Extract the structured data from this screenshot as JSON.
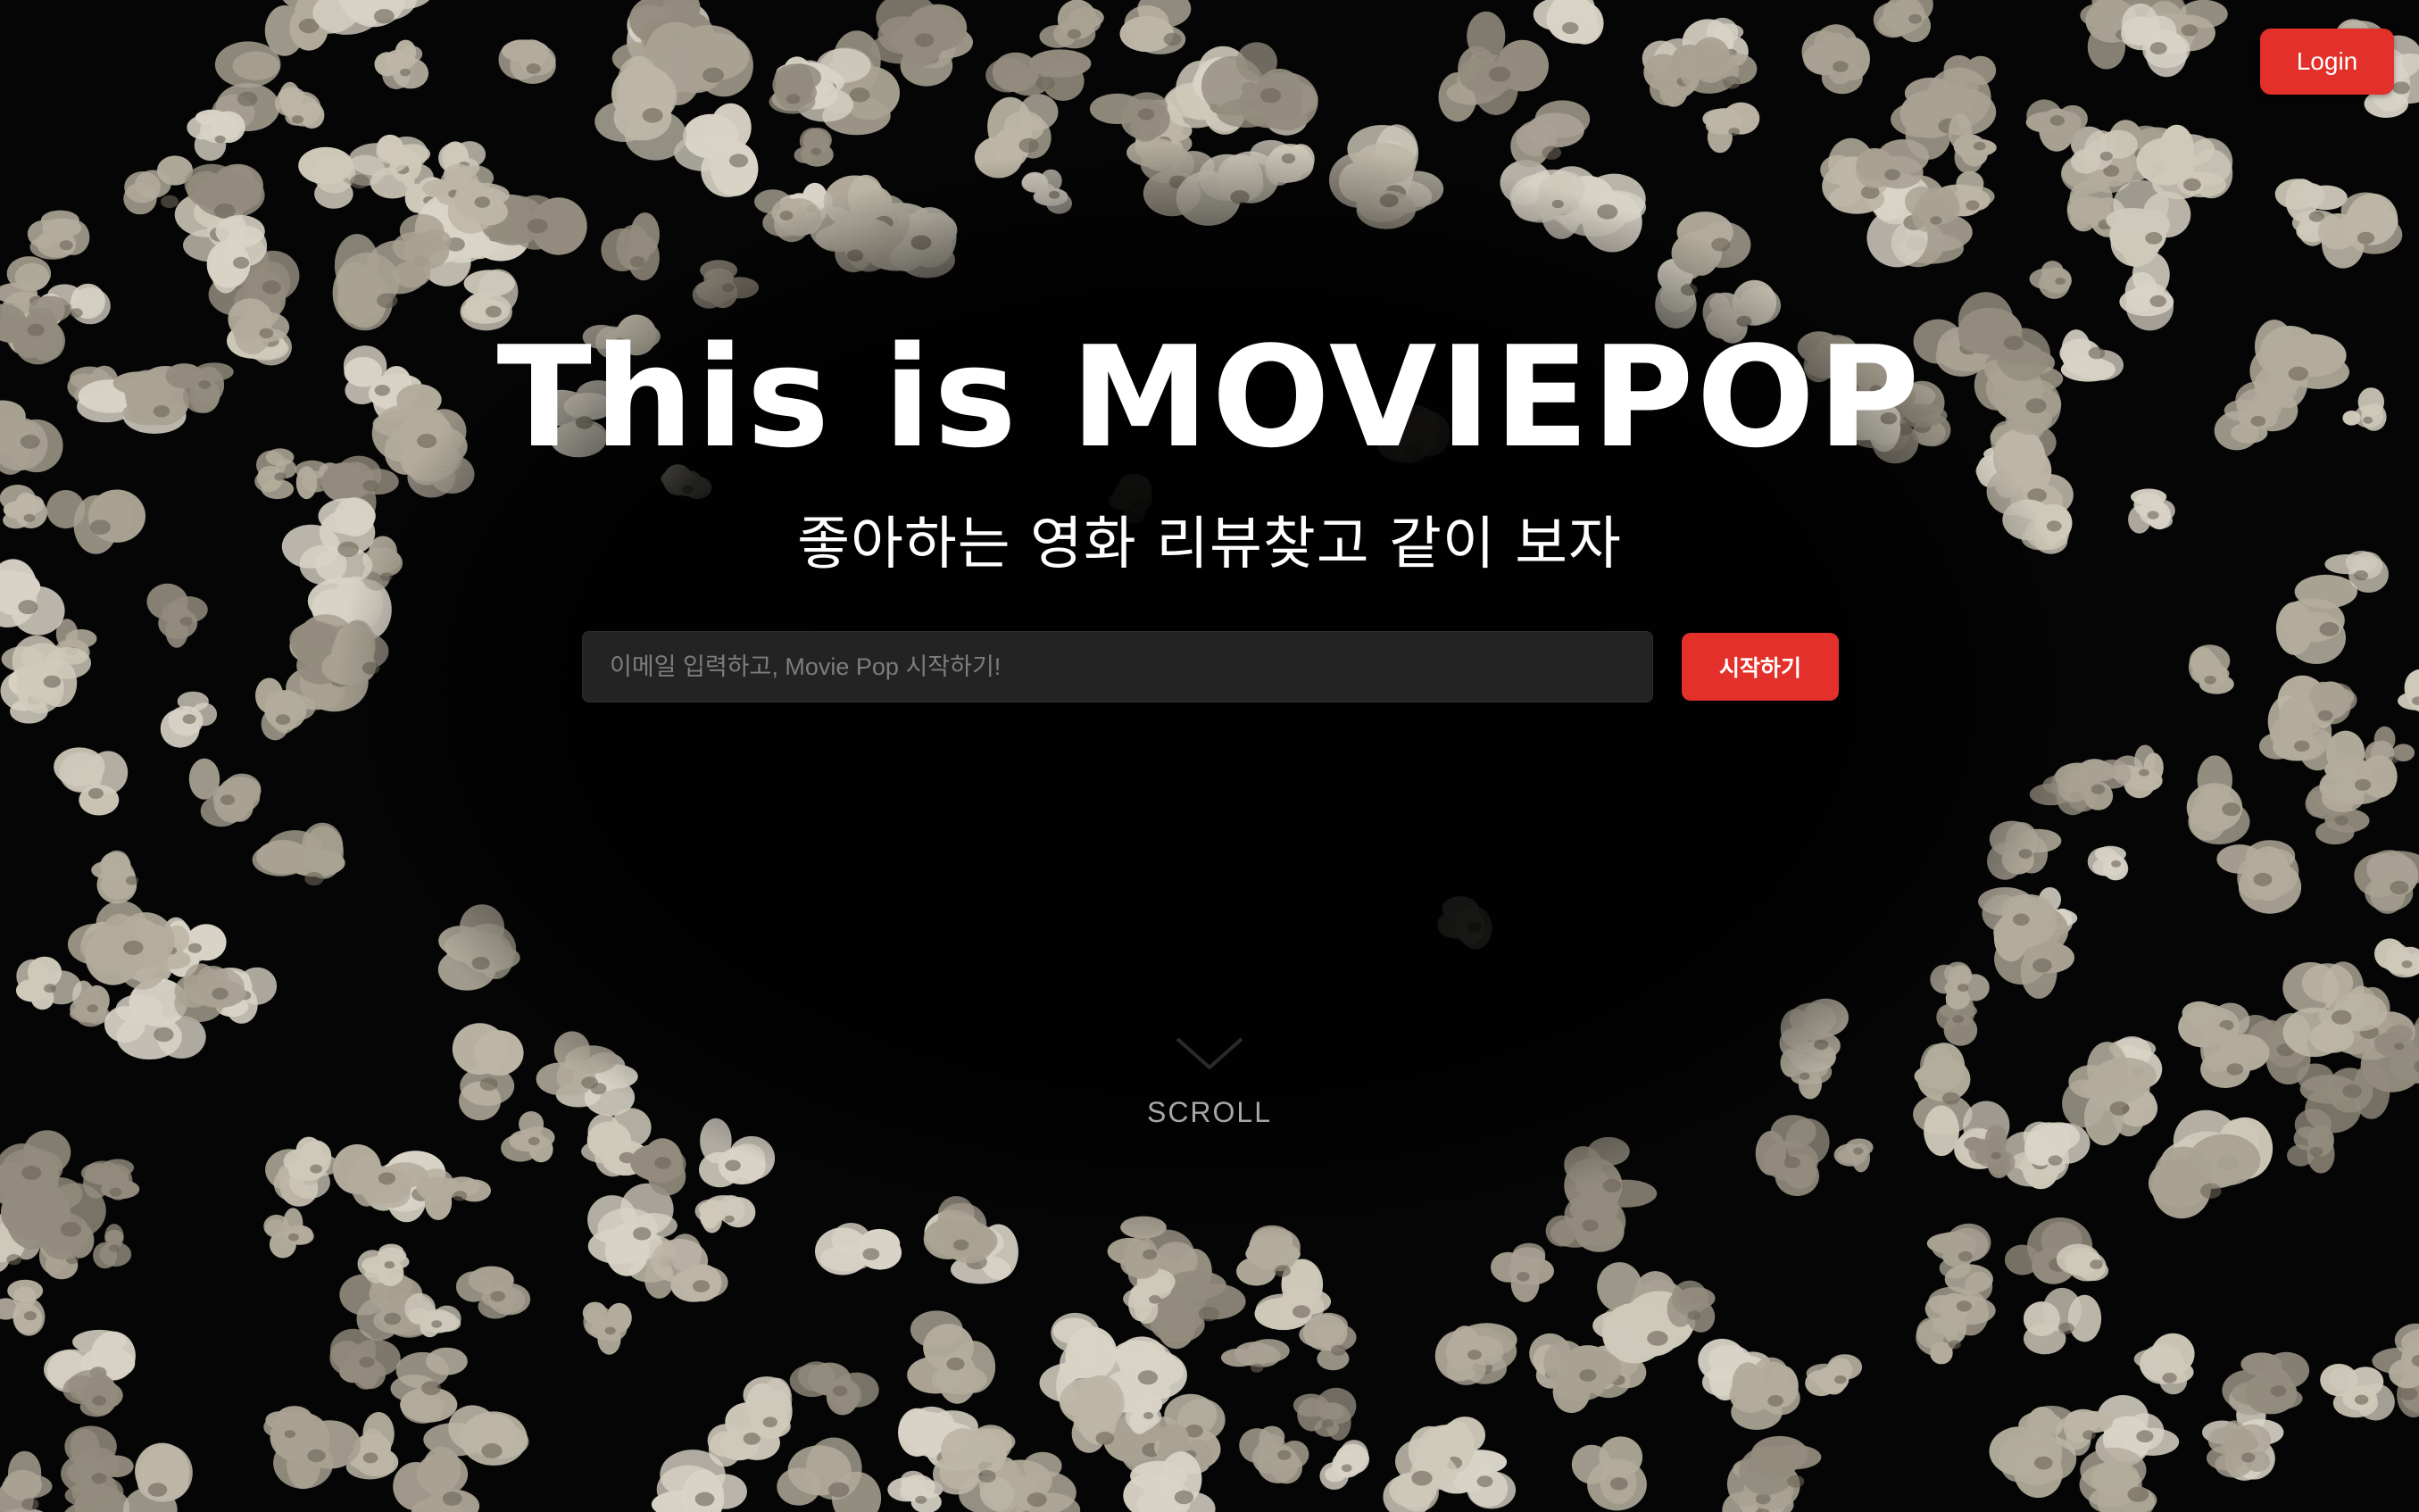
{
  "header": {
    "login_label": "Login"
  },
  "hero": {
    "title": "This is MOVIEPOP",
    "subtitle": "좋아하는 영화 리뷰찾고 같이 보자"
  },
  "signup": {
    "email_placeholder": "이메일 입력하고, Movie Pop 시작하기!",
    "start_label": "시작하기"
  },
  "scroll": {
    "label": "SCROLL"
  },
  "colors": {
    "accent": "#e3302a",
    "background": "#000000",
    "input_bg": "#232323",
    "popcorn": "#c9c3b4"
  }
}
